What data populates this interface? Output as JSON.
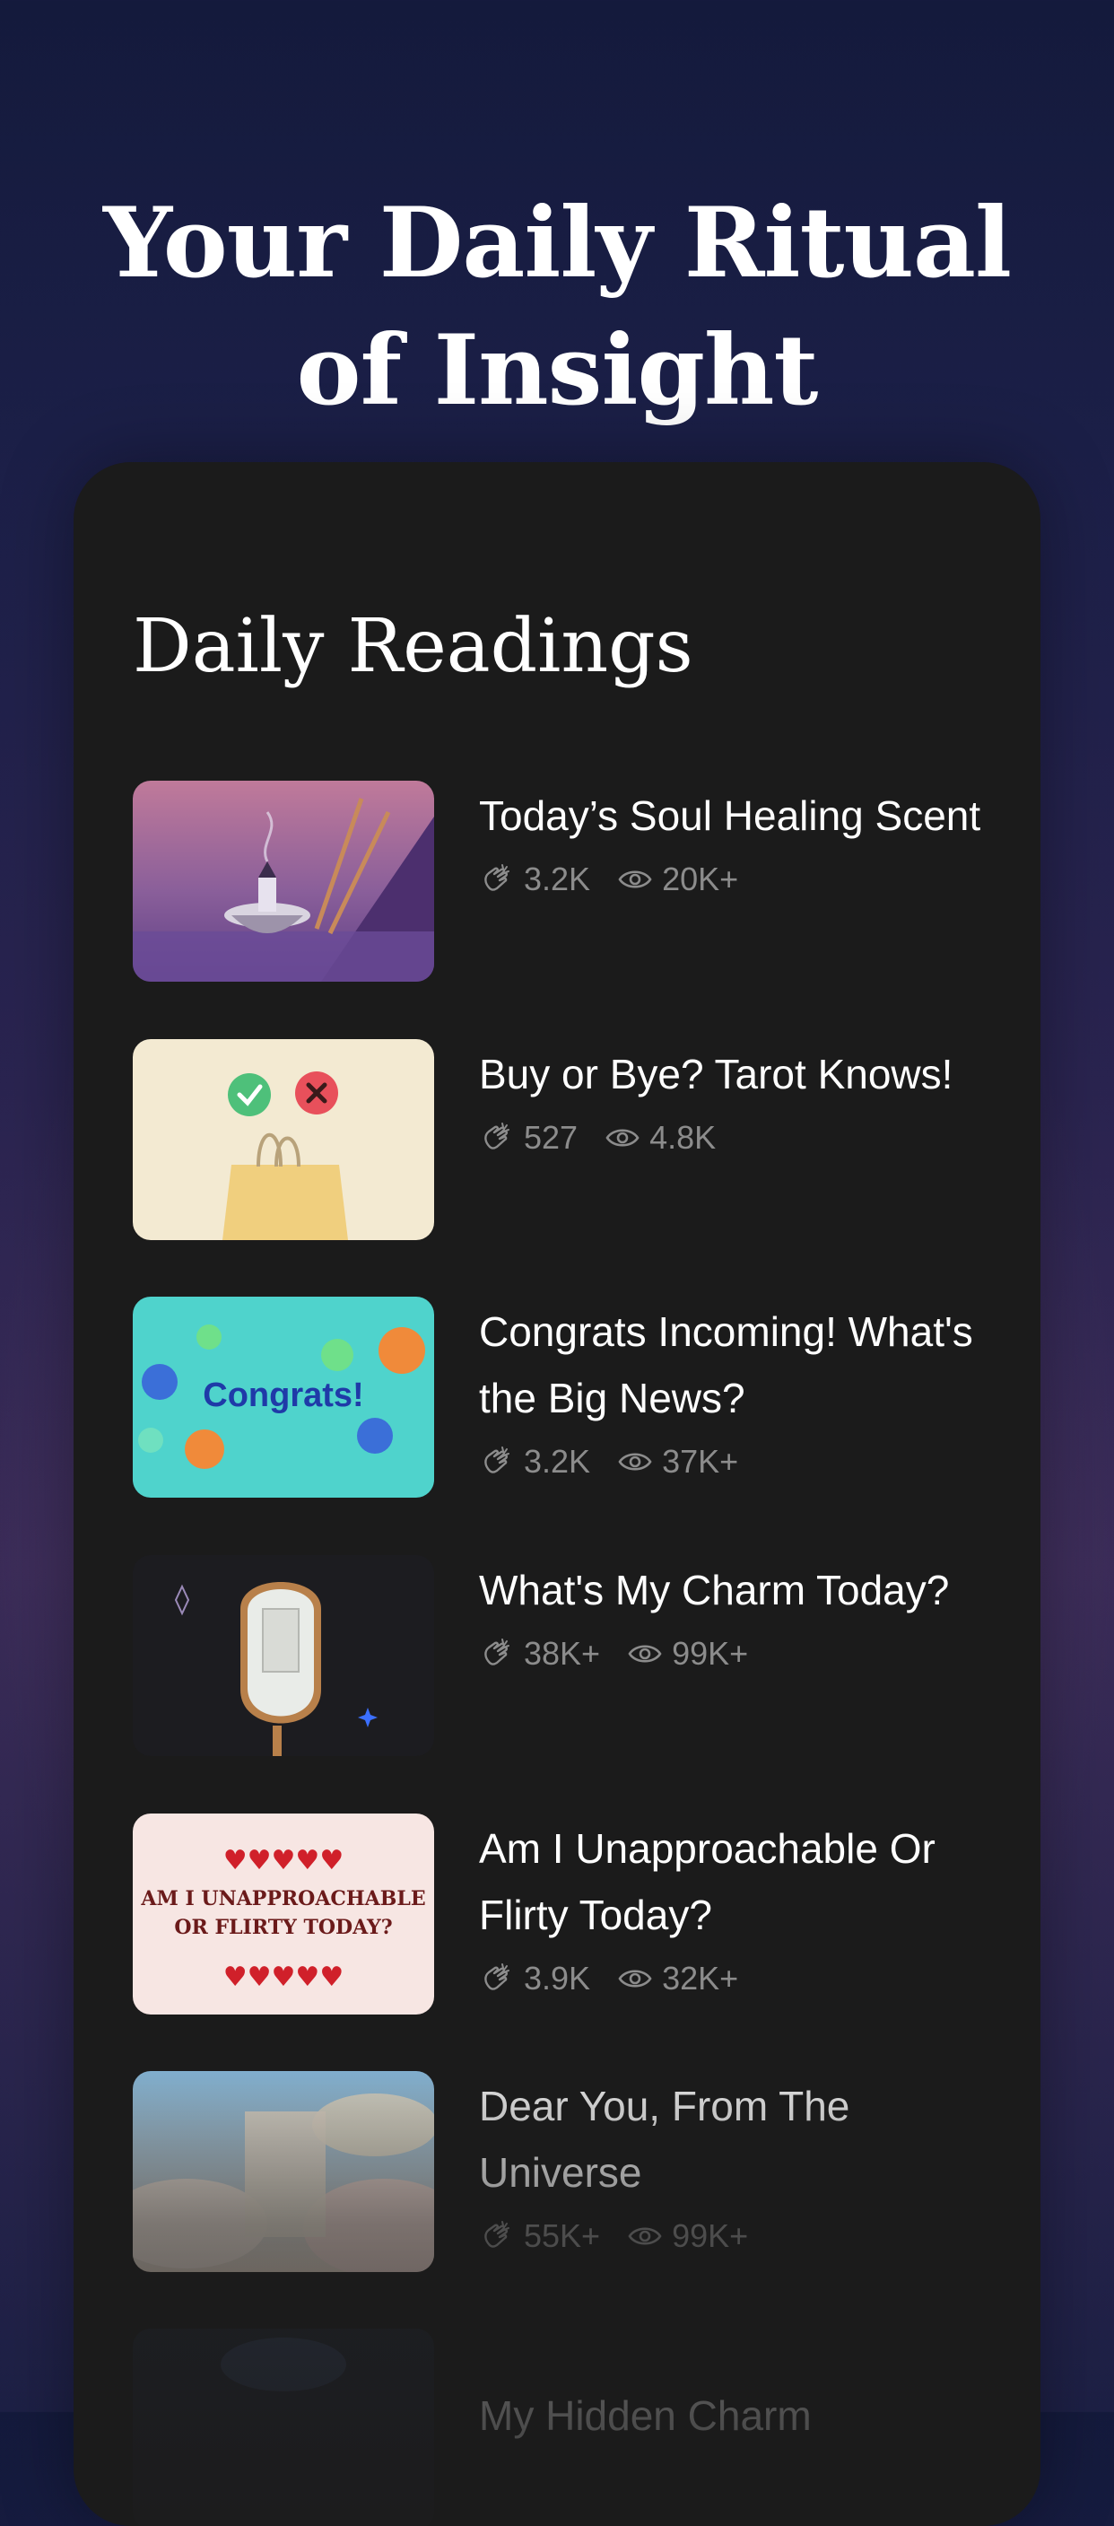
{
  "hero": {
    "line1": "Your Daily Ritual",
    "line2": "of Insight"
  },
  "section": {
    "title": "Daily Readings"
  },
  "readings": [
    {
      "title": "Today’s Soul Healing Scent",
      "claps": "3.2K",
      "views": "20K+"
    },
    {
      "title": "Buy or Bye? Tarot Knows!",
      "claps": "527",
      "views": "4.8K"
    },
    {
      "title": "Congrats Incoming! What's the Big News?",
      "claps": "3.2K",
      "views": "37K+",
      "thumb_text": "Congrats!"
    },
    {
      "title": "What's My Charm Today?",
      "claps": "38K+",
      "views": "99K+"
    },
    {
      "title": "Am I Unapproachable Or Flirty Today?",
      "claps": "3.9K",
      "views": "32K+",
      "thumb_text_1": "AM I UNAPPROACHABLE",
      "thumb_text_2": "OR FLIRTY TODAY?"
    },
    {
      "title": "Dear You, From The Universe",
      "claps": "55K+",
      "views": "99K+"
    },
    {
      "title": "My Hidden Charm"
    }
  ],
  "icons": {
    "claps": "clap-icon",
    "views": "eye-icon"
  },
  "colors": {
    "card_bg": "#1b1b1b",
    "text_primary": "#ffffff",
    "text_muted": "#8c8c8c"
  }
}
